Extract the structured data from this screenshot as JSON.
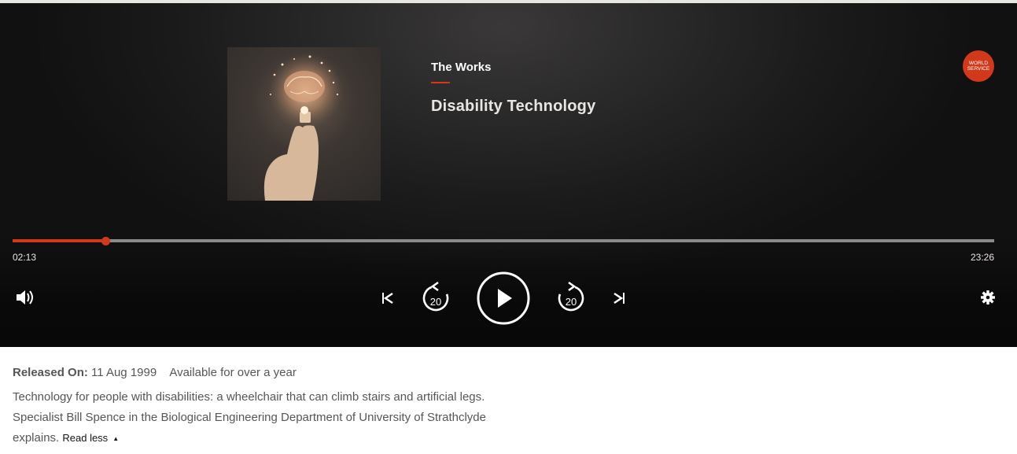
{
  "player": {
    "show_title": "The Works",
    "episode_title": "Disability Technology",
    "network_logo": "WORLD SERVICE",
    "artwork_icon": "lightbulb-brain-artwork",
    "progress": {
      "elapsed": "02:13",
      "total": "23:26",
      "fraction": 0.0946
    },
    "controls": {
      "volume_icon": "speaker-icon",
      "previous_icon": "skip-previous-icon",
      "rewind_label": "20",
      "play_icon": "play-icon",
      "forward_label": "20",
      "next_icon": "skip-next-icon",
      "settings_icon": "gear-icon"
    },
    "colors": {
      "accent": "#d2391b",
      "track": "#8a8a8a",
      "text": "#e9e6e2"
    }
  },
  "details": {
    "released_label": "Released On:",
    "released_date": "11 Aug 1999",
    "availability": "Available for over a year",
    "description": "Technology for people with disabilities: a wheelchair that can climb stairs and artificial legs. Specialist Bill Spence in the Biological Engineering Department of University of Strathclyde explains.",
    "read_less_label": "Read less",
    "read_less_icon": "triangle-up-icon"
  }
}
